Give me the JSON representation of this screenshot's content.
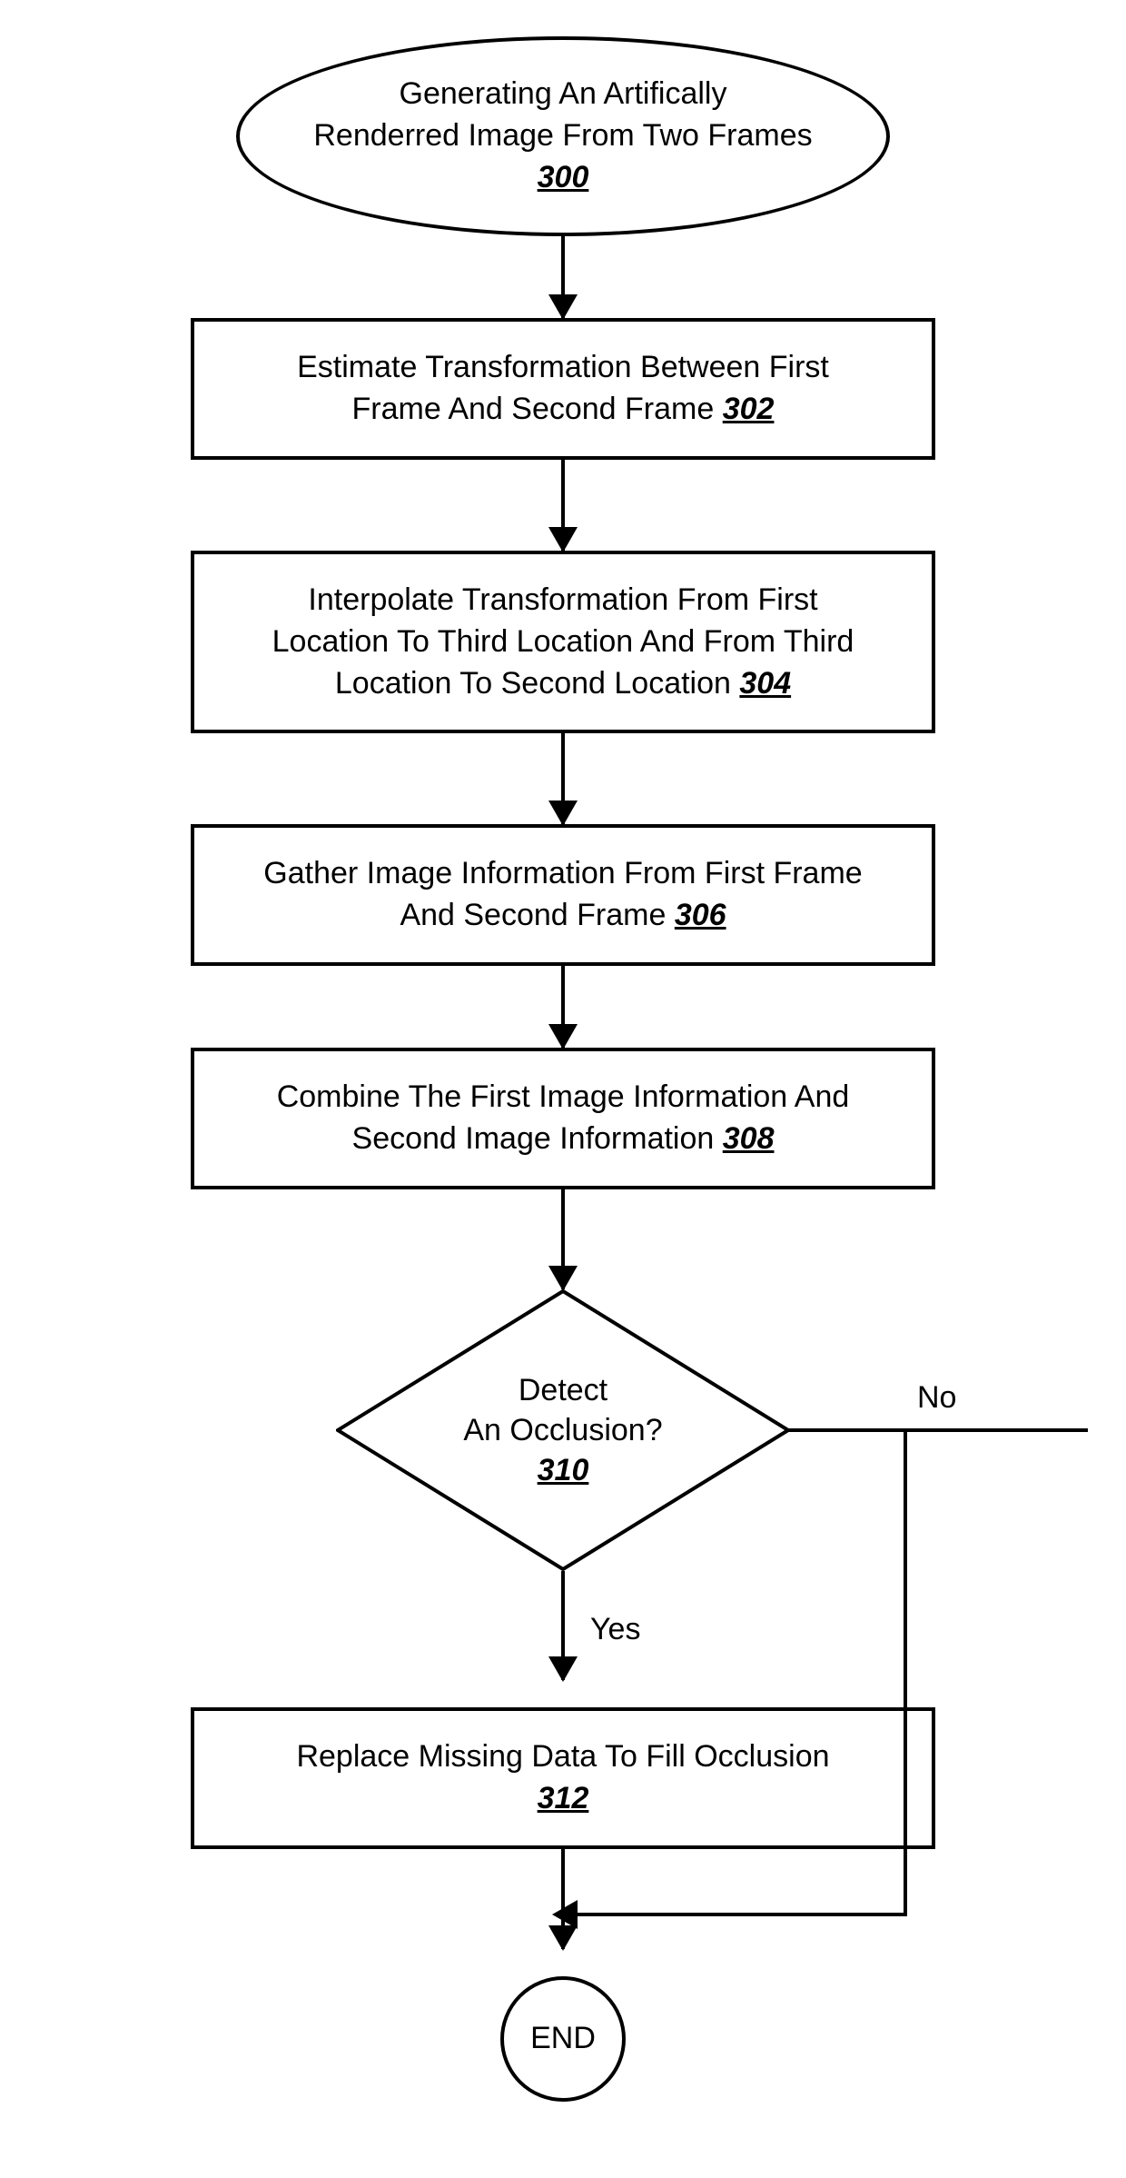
{
  "chart_data": {
    "type": "flowchart",
    "nodes": [
      {
        "id": "300",
        "shape": "ellipse",
        "text": "Generating An Artifically Renderred Image From Two Frames",
        "ref": "300"
      },
      {
        "id": "302",
        "shape": "rect",
        "text": "Estimate Transformation Between First Frame And Second Frame",
        "ref": "302"
      },
      {
        "id": "304",
        "shape": "rect",
        "text": "Interpolate Transformation From First Location To Third Location And From Third Location To Second Location",
        "ref": "304"
      },
      {
        "id": "306",
        "shape": "rect",
        "text": "Gather Image Information From First Frame And Second Frame",
        "ref": "306"
      },
      {
        "id": "308",
        "shape": "rect",
        "text": "Combine The First Image Information And Second Image Information",
        "ref": "308"
      },
      {
        "id": "310",
        "shape": "diamond",
        "text": "Detect An Occlusion?",
        "ref": "310"
      },
      {
        "id": "312",
        "shape": "rect",
        "text": "Replace Missing Data To Fill Occlusion",
        "ref": "312"
      },
      {
        "id": "END",
        "shape": "terminal",
        "text": "END"
      }
    ],
    "edges": [
      {
        "from": "300",
        "to": "302"
      },
      {
        "from": "302",
        "to": "304"
      },
      {
        "from": "304",
        "to": "306"
      },
      {
        "from": "306",
        "to": "308"
      },
      {
        "from": "308",
        "to": "310"
      },
      {
        "from": "310",
        "to": "312",
        "label": "Yes"
      },
      {
        "from": "310",
        "to": "END",
        "label": "No"
      },
      {
        "from": "312",
        "to": "END"
      }
    ]
  },
  "nodes": {
    "n300": {
      "line1": "Generating An Artifically",
      "line2": "Renderred Image From Two Frames",
      "ref": "300"
    },
    "n302": {
      "line1": "Estimate Transformation Between First",
      "line2": "Frame And Second Frame ",
      "ref": "302"
    },
    "n304": {
      "line1": "Interpolate Transformation From First",
      "line2": "Location To Third Location And From Third",
      "line3": "Location To Second Location ",
      "ref": "304"
    },
    "n306": {
      "line1": "Gather Image Information From First Frame",
      "line2": "And Second Frame ",
      "ref": "306"
    },
    "n308": {
      "line1": "Combine The First Image Information And",
      "line2": "Second Image Information ",
      "ref": "308"
    },
    "n310": {
      "line1": "Detect",
      "line2": "An Occlusion?",
      "ref": "310"
    },
    "n312": {
      "line1": "Replace Missing Data To Fill Occlusion",
      "ref": "312"
    },
    "end": {
      "text": "END"
    }
  },
  "labels": {
    "yes": "Yes",
    "no": "No"
  }
}
